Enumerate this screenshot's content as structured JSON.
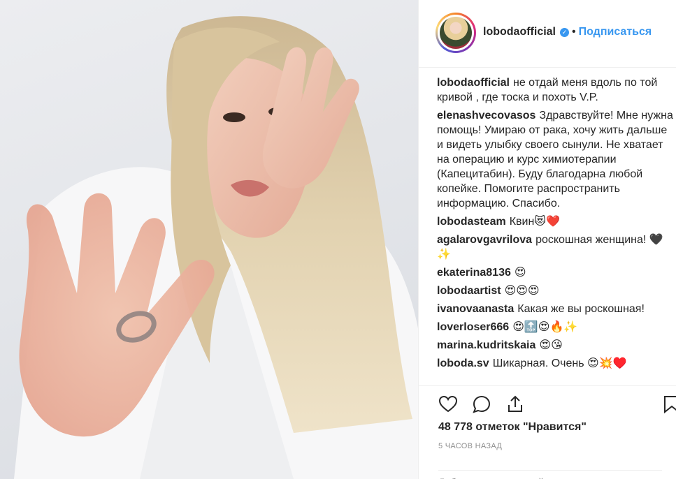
{
  "post": {
    "username": "lobodaofficial",
    "verified_mark": "✓",
    "separator": "•",
    "follow_label": "Подписаться",
    "caption": "не отдай меня вдоль по той кривой , где тоска и похоть V.P."
  },
  "comments": [
    {
      "user": "elenashvecovasos",
      "text": "Здравствуйте! Мне нужна помощь! Умираю от рака, хочу жить дальше и видеть улыбку своего сынули. Не хватает на операцию и курс химиотерапии (Капецитабин). Буду благодарна любой копейке. Помогите распространить информацию. Спасибо."
    },
    {
      "user": "lobodasteam",
      "text": "Квин😻❤️"
    },
    {
      "user": "agalarovgavrilova",
      "text": "роскошная женщина! 🖤✨"
    },
    {
      "user": "ekaterina8136",
      "text": "😍"
    },
    {
      "user": "lobodaartist",
      "text": "😍😍😍"
    },
    {
      "user": "ivanovaanasta",
      "text": "Какая же вы роскошная!"
    },
    {
      "user": "loverloser666",
      "text": "😍🔝😍🔥✨"
    },
    {
      "user": "marina.kudritskaia",
      "text": "😍😘"
    },
    {
      "user": "loboda.sv",
      "text": "Шикарная. Очень 😍💥♥️"
    }
  ],
  "actions": {
    "like_icon": "heart-icon",
    "comment_icon": "comment-icon",
    "share_icon": "share-icon",
    "save_icon": "bookmark-icon"
  },
  "likes_text": "48 778 отметок \"Нравится\"",
  "time_text": "5 ЧАСОВ НАЗАД",
  "add_comment_placeholder": "Добавьте комментарий...",
  "colors": {
    "link": "#3897f0",
    "verified": "#3897f0",
    "muted": "#8e8e8e"
  }
}
